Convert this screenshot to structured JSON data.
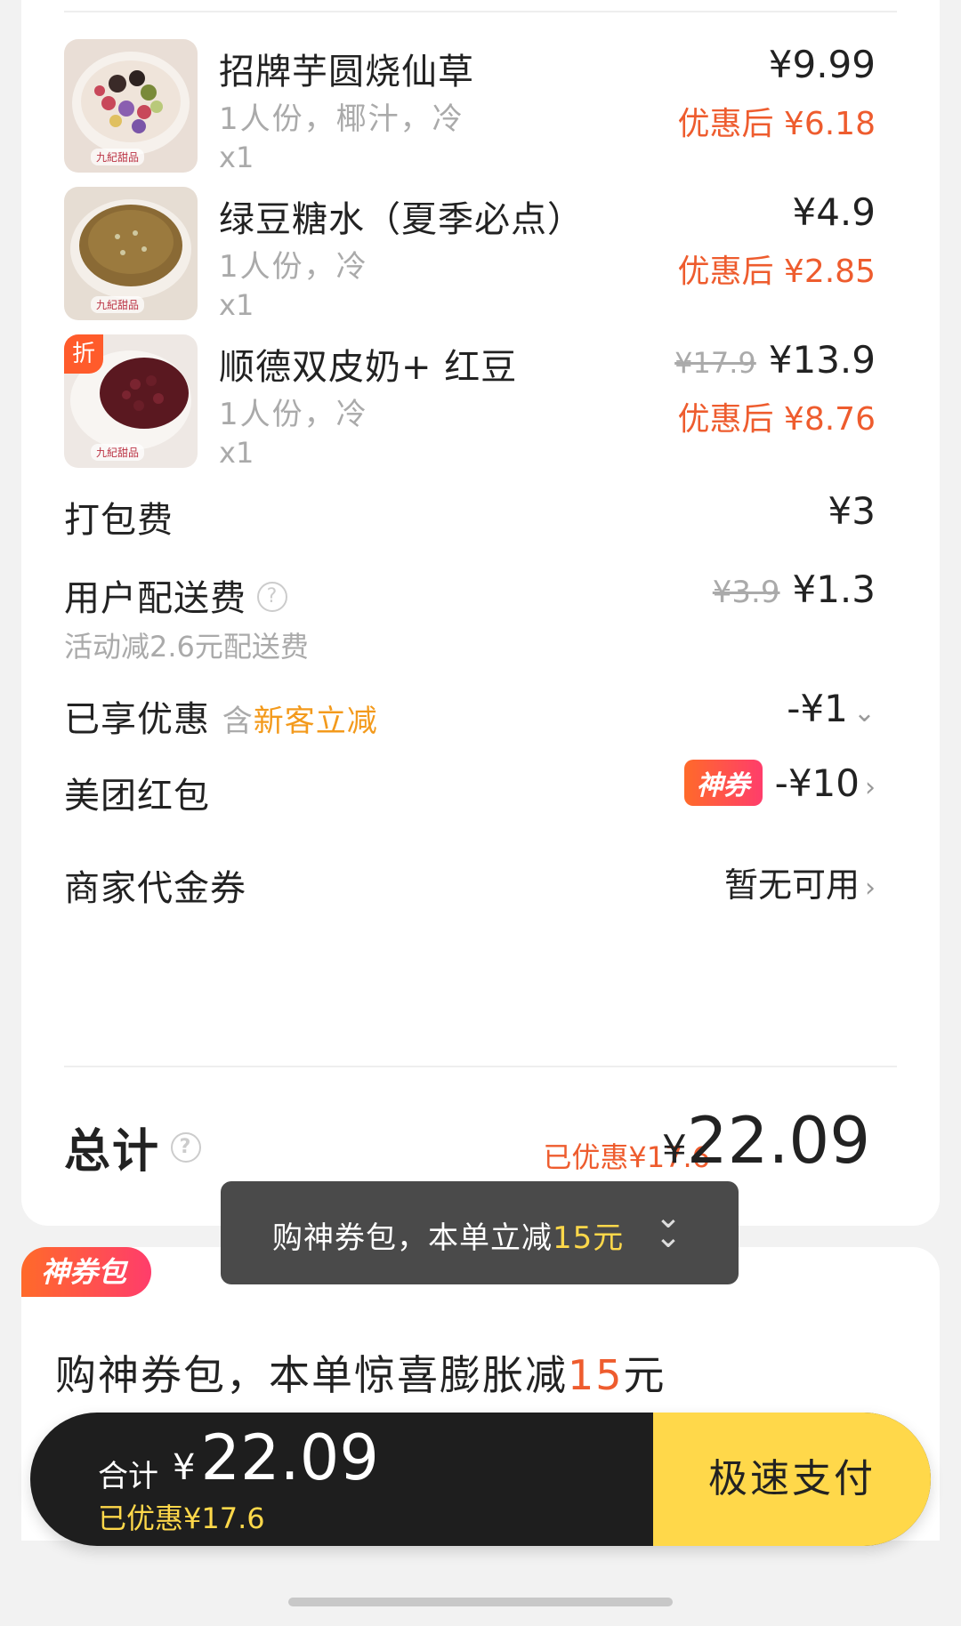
{
  "items": [
    {
      "name": "招牌芋圆烧仙草",
      "spec": "1人份，椰汁，冷",
      "qty": "x1",
      "price": "¥9.99",
      "orig_price": "",
      "after_label": "优惠后 ¥6.18",
      "watermark": "九紀甜品",
      "badge": ""
    },
    {
      "name": "绿豆糖水（夏季必点）",
      "spec": "1人份，冷",
      "qty": "x1",
      "price": "¥4.9",
      "orig_price": "",
      "after_label": "优惠后 ¥2.85",
      "watermark": "九紀甜品",
      "badge": ""
    },
    {
      "name": "顺德双皮奶+ 红豆",
      "spec": "1人份，冷",
      "qty": "x1",
      "price": "¥13.9",
      "orig_price": "¥17.9",
      "after_label": "优惠后 ¥8.76",
      "watermark": "九紀甜品",
      "badge": "折"
    }
  ],
  "packing": {
    "label": "打包费",
    "value": "¥3"
  },
  "delivery": {
    "label": "用户配送费",
    "help_icon": "?",
    "orig": "¥3.9",
    "value": "¥1.3",
    "note": "活动减2.6元配送费"
  },
  "discount": {
    "label": "已享优惠",
    "prefix": "含",
    "desc": "新客立减",
    "value": "-¥1",
    "chevron": "⌄"
  },
  "redpacket": {
    "label": "美团红包",
    "tag": "神券",
    "value": "-¥10",
    "chevron": "›"
  },
  "voucher": {
    "label": "商家代金券",
    "value": "暂无可用",
    "chevron": "›"
  },
  "total": {
    "label": "总计",
    "help_icon": "?",
    "saved": "已优惠¥17.6",
    "currency": "¥",
    "amount": "22.09"
  },
  "toast": {
    "text": "购神券包，本单立减",
    "highlight": "15元",
    "chevron": "⌄⌄"
  },
  "coupon_pack": {
    "tag": "神券包",
    "title": "购神券包，本单惊喜膨胀减",
    "highlight": "15",
    "title_suffix": "元"
  },
  "paybar": {
    "label": "合计",
    "currency": "¥",
    "amount": "22.09",
    "saved": "已优惠¥17.6",
    "button": "极速支付"
  },
  "colors": {
    "accent_red": "#ee5c2e",
    "accent_orange": "#f39a1c",
    "pay_yellow": "#ffd84a",
    "paybar_dark": "#1e1e1e"
  }
}
